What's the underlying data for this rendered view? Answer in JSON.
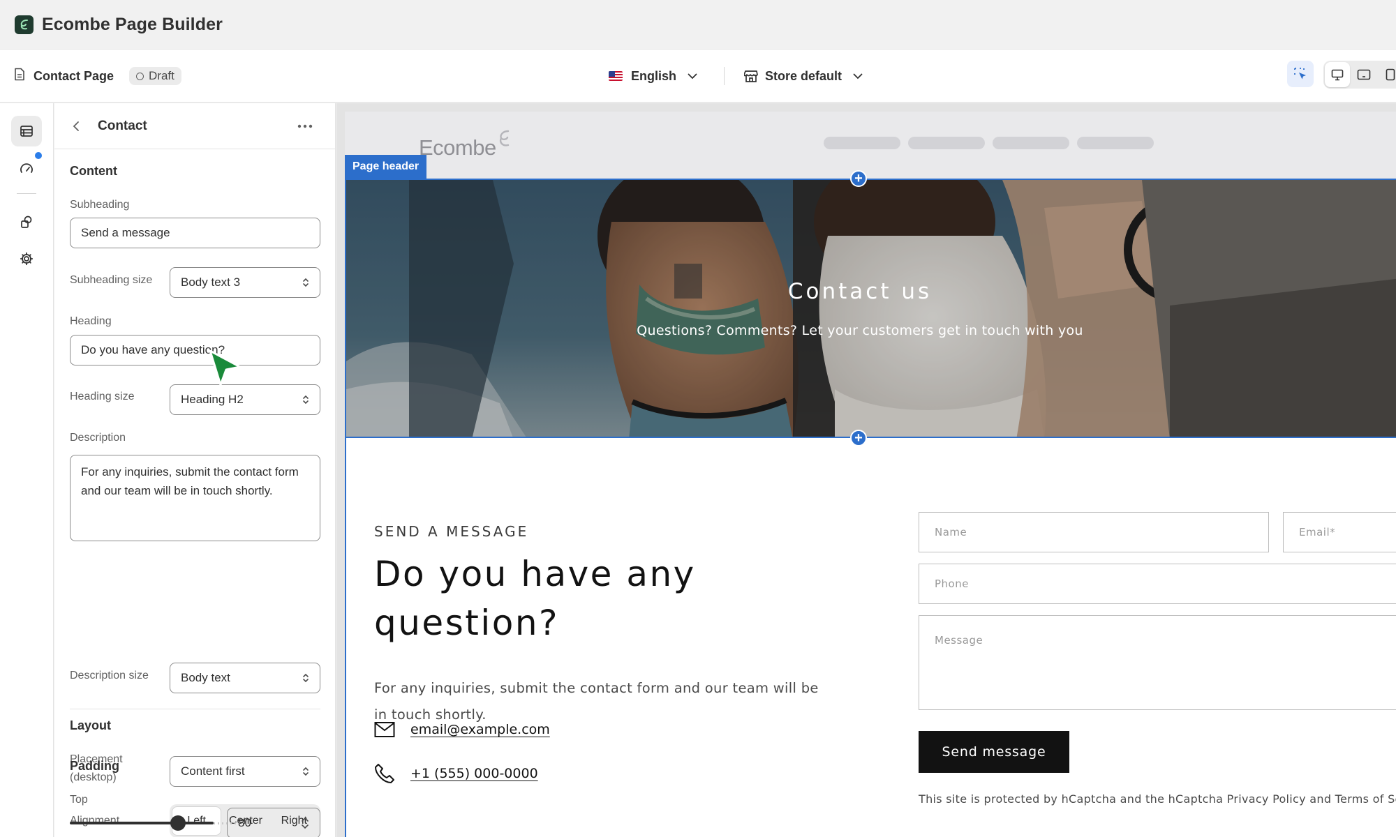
{
  "app": {
    "title": "Ecombe Page Builder"
  },
  "toolbar": {
    "page_name": "Contact Page",
    "status": "Draft",
    "language": "English",
    "store": "Store default"
  },
  "panel": {
    "title": "Contact",
    "content_section": "Content",
    "subheading_label": "Subheading",
    "subheading_value": "Send a message",
    "subheading_size_label": "Subheading size",
    "subheading_size_value": "Body text 3",
    "heading_label": "Heading",
    "heading_value": "Do you have any question?",
    "heading_size_label": "Heading size",
    "heading_size_value": "Heading H2",
    "description_label": "Description",
    "description_value": "For any inquiries, submit the contact form and our team will be in touch shortly.",
    "description_size_label": "Description size",
    "description_size_value": "Body text",
    "layout_section": "Layout",
    "placement_label_line1": "Placement",
    "placement_label_line2": "(desktop)",
    "placement_value": "Content first",
    "alignment_label": "Alignment",
    "alignment_options": [
      "Left",
      "Center",
      "Right"
    ],
    "alignment_selected": "Left",
    "padding_section": "Padding",
    "top_label": "Top",
    "top_value": "80"
  },
  "preview": {
    "site_logo": "Ecombe",
    "page_header_tag": "Page header",
    "hero_title": "Contact us",
    "hero_subtitle": "Questions? Comments? Let your customers get in touch with you",
    "section_subheading": "SEND A MESSAGE",
    "section_heading": "Do you have any question?",
    "section_description": "For any inquiries, submit the contact form and our team will be in touch shortly.",
    "email": "email@example.com",
    "phone": "+1 (555) 000-0000",
    "form": {
      "name_placeholder": "Name",
      "email_placeholder": "Email*",
      "phone_placeholder": "Phone",
      "message_placeholder": "Message",
      "submit_label": "Send message"
    },
    "captcha_notice": "This site is protected by hCaptcha and the hCaptcha Privacy Policy and Terms of Serv"
  },
  "colors": {
    "accent_blue": "#2c6ecb",
    "rail_badge": "#2b7de9",
    "cursor_green": "#1a8a3a",
    "logo_dark": "#1f3b2f"
  }
}
